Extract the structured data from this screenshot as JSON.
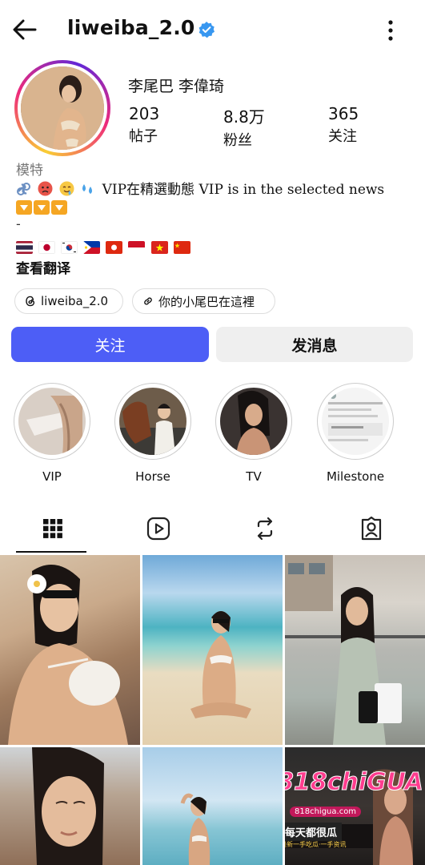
{
  "header": {
    "username": "liweiba_2.0"
  },
  "profile": {
    "display_name": "李尾巴 李偉琦",
    "stats": [
      {
        "value": "203",
        "label": "帖子"
      },
      {
        "value": "8.8万",
        "label": "粉丝"
      },
      {
        "value": "365",
        "label": "关注"
      }
    ],
    "category": "模特",
    "bio_text": "VIP在精選動態 VIP is in the selected news",
    "bio_dash": "-",
    "translate_label": "查看翻译"
  },
  "chips": {
    "threads": "liweiba_2.0",
    "link": "你的小尾巴在這裡"
  },
  "buttons": {
    "follow": "关注",
    "message": "发消息"
  },
  "highlights": [
    {
      "label": "VIP"
    },
    {
      "label": "Horse"
    },
    {
      "label": "TV"
    },
    {
      "label": "Milestone"
    }
  ],
  "watermark": {
    "logo": "818chiGUA",
    "site": "818chigua.com",
    "tagline": "每天都很瓜",
    "small": "最新一手吃瓜·一手资讯"
  },
  "colors": {
    "follow_button": "#4d5ef6",
    "message_button": "#efefef",
    "verified": "#3897f0"
  },
  "icons": {
    "back": "back-arrow-icon",
    "verified": "verified-badge-icon",
    "more": "more-vertical-icon",
    "threads": "threads-icon",
    "link": "link-icon",
    "grid": "grid-icon",
    "reels": "reels-icon",
    "reposts": "repost-icon",
    "tagged": "tagged-icon"
  }
}
